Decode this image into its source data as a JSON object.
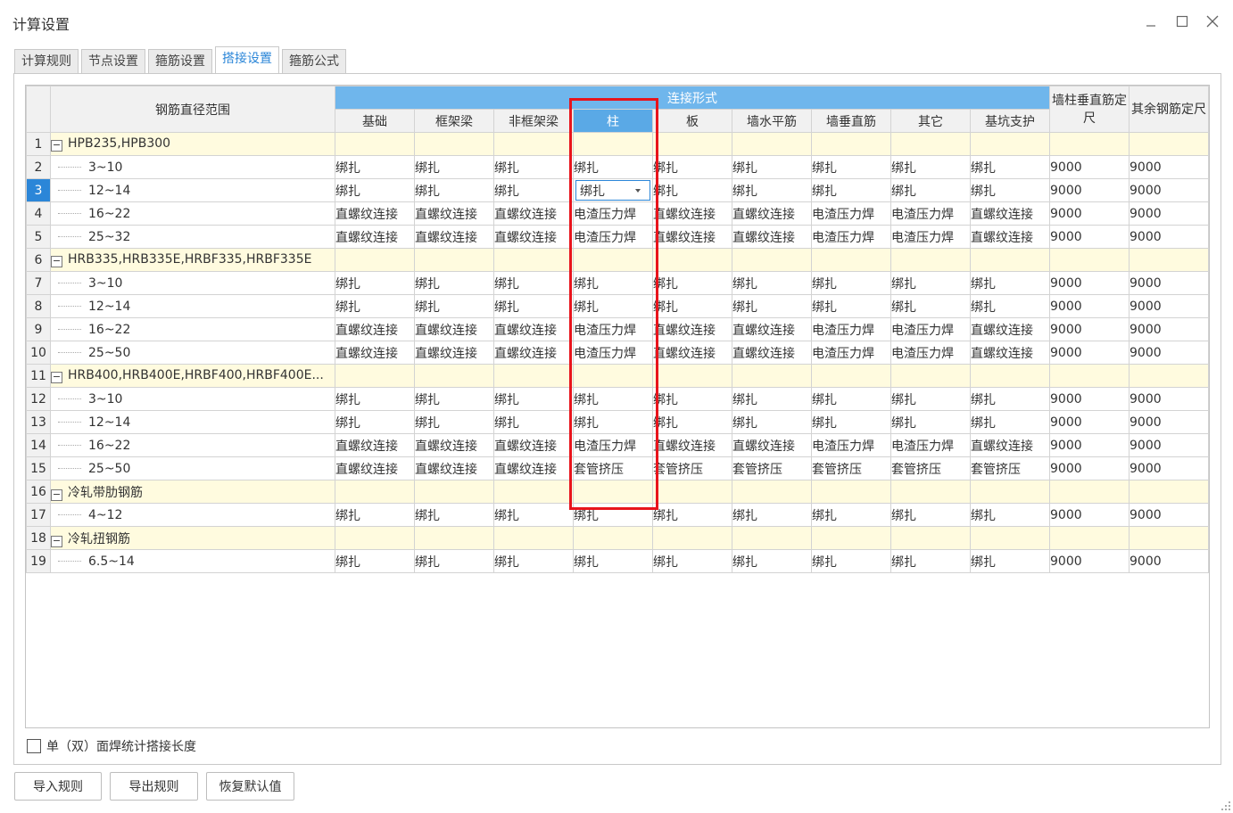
{
  "window": {
    "title": "计算设置"
  },
  "tabs": [
    "计算规则",
    "节点设置",
    "箍筋设置",
    "搭接设置",
    "箍筋公式"
  ],
  "active_tab": "搭接设置",
  "table": {
    "col_range": "钢筋直径范围",
    "group_header": "连接形式",
    "sub_headers": [
      "基础",
      "框架梁",
      "非框架梁",
      "柱",
      "板",
      "墙水平筋",
      "墙垂直筋",
      "其它",
      "基坑支护"
    ],
    "extra_headers": [
      "墙柱垂直筋定尺",
      "其余钢筋定尺"
    ],
    "selected_row": "3",
    "rows": [
      {
        "n": "1",
        "group": true,
        "name": "HPB235,HPB300"
      },
      {
        "n": "2",
        "name": "3~10",
        "cells": [
          "绑扎",
          "绑扎",
          "绑扎",
          "绑扎",
          "绑扎",
          "绑扎",
          "绑扎",
          "绑扎",
          "绑扎",
          "9000",
          "9000"
        ]
      },
      {
        "n": "3",
        "name": "12~14",
        "cells": [
          "绑扎",
          "绑扎",
          "绑扎",
          "绑扎",
          "绑扎",
          "绑扎",
          "绑扎",
          "绑扎",
          "绑扎",
          "9000",
          "9000"
        ]
      },
      {
        "n": "4",
        "name": "16~22",
        "cells": [
          "直螺纹连接",
          "直螺纹连接",
          "直螺纹连接",
          "电渣压力焊",
          "直螺纹连接",
          "直螺纹连接",
          "电渣压力焊",
          "电渣压力焊",
          "直螺纹连接",
          "9000",
          "9000"
        ]
      },
      {
        "n": "5",
        "name": "25~32",
        "cells": [
          "直螺纹连接",
          "直螺纹连接",
          "直螺纹连接",
          "电渣压力焊",
          "直螺纹连接",
          "直螺纹连接",
          "电渣压力焊",
          "电渣压力焊",
          "直螺纹连接",
          "9000",
          "9000"
        ]
      },
      {
        "n": "6",
        "group": true,
        "name": "HRB335,HRB335E,HRBF335,HRBF335E"
      },
      {
        "n": "7",
        "name": "3~10",
        "cells": [
          "绑扎",
          "绑扎",
          "绑扎",
          "绑扎",
          "绑扎",
          "绑扎",
          "绑扎",
          "绑扎",
          "绑扎",
          "9000",
          "9000"
        ]
      },
      {
        "n": "8",
        "name": "12~14",
        "cells": [
          "绑扎",
          "绑扎",
          "绑扎",
          "绑扎",
          "绑扎",
          "绑扎",
          "绑扎",
          "绑扎",
          "绑扎",
          "9000",
          "9000"
        ]
      },
      {
        "n": "9",
        "name": "16~22",
        "cells": [
          "直螺纹连接",
          "直螺纹连接",
          "直螺纹连接",
          "电渣压力焊",
          "直螺纹连接",
          "直螺纹连接",
          "电渣压力焊",
          "电渣压力焊",
          "直螺纹连接",
          "9000",
          "9000"
        ]
      },
      {
        "n": "10",
        "name": "25~50",
        "cells": [
          "直螺纹连接",
          "直螺纹连接",
          "直螺纹连接",
          "电渣压力焊",
          "直螺纹连接",
          "直螺纹连接",
          "电渣压力焊",
          "电渣压力焊",
          "直螺纹连接",
          "9000",
          "9000"
        ]
      },
      {
        "n": "11",
        "group": true,
        "name": "HRB400,HRB400E,HRBF400,HRBF400E..."
      },
      {
        "n": "12",
        "name": "3~10",
        "cells": [
          "绑扎",
          "绑扎",
          "绑扎",
          "绑扎",
          "绑扎",
          "绑扎",
          "绑扎",
          "绑扎",
          "绑扎",
          "9000",
          "9000"
        ]
      },
      {
        "n": "13",
        "name": "12~14",
        "cells": [
          "绑扎",
          "绑扎",
          "绑扎",
          "绑扎",
          "绑扎",
          "绑扎",
          "绑扎",
          "绑扎",
          "绑扎",
          "9000",
          "9000"
        ]
      },
      {
        "n": "14",
        "name": "16~22",
        "cells": [
          "直螺纹连接",
          "直螺纹连接",
          "直螺纹连接",
          "电渣压力焊",
          "直螺纹连接",
          "直螺纹连接",
          "电渣压力焊",
          "电渣压力焊",
          "直螺纹连接",
          "9000",
          "9000"
        ]
      },
      {
        "n": "15",
        "name": "25~50",
        "cells": [
          "直螺纹连接",
          "直螺纹连接",
          "直螺纹连接",
          "套管挤压",
          "套管挤压",
          "套管挤压",
          "套管挤压",
          "套管挤压",
          "套管挤压",
          "9000",
          "9000"
        ]
      },
      {
        "n": "16",
        "group": true,
        "name": "冷轧带肋钢筋"
      },
      {
        "n": "17",
        "name": "4~12",
        "cells": [
          "绑扎",
          "绑扎",
          "绑扎",
          "绑扎",
          "绑扎",
          "绑扎",
          "绑扎",
          "绑扎",
          "绑扎",
          "9000",
          "9000"
        ]
      },
      {
        "n": "18",
        "group": true,
        "name": "冷轧扭钢筋"
      },
      {
        "n": "19",
        "name": "6.5~14",
        "cells": [
          "绑扎",
          "绑扎",
          "绑扎",
          "绑扎",
          "绑扎",
          "绑扎",
          "绑扎",
          "绑扎",
          "绑扎",
          "9000",
          "9000"
        ]
      }
    ]
  },
  "checkbox_label": "单（双）面焊统计搭接长度",
  "buttons": {
    "import": "导入规则",
    "export": "导出规则",
    "restore": "恢复默认值"
  }
}
